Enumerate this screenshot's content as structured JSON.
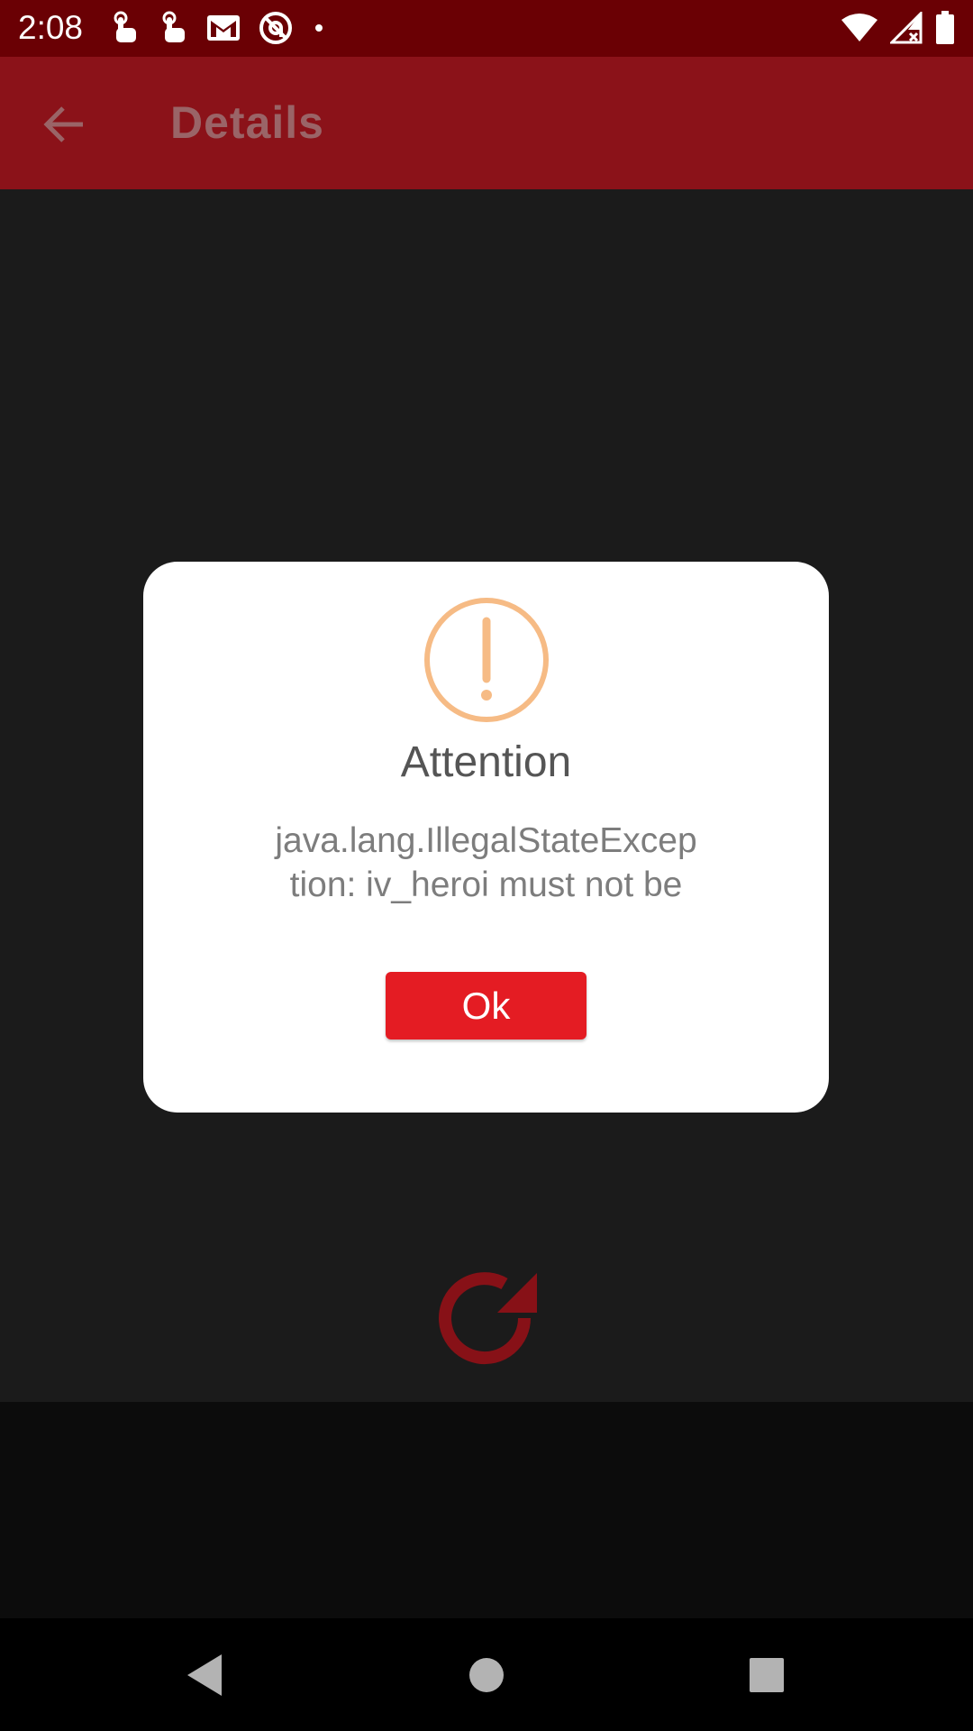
{
  "status_bar": {
    "time": "2:08",
    "icons": [
      "touch-icon",
      "touch-icon",
      "gmail-icon",
      "at-sign-icon",
      "dot-icon",
      "wifi-icon",
      "signal-icon",
      "battery-icon"
    ]
  },
  "app_bar": {
    "title": "Details",
    "back_icon": "arrow-back-icon"
  },
  "dialog": {
    "icon": "warning-icon",
    "title": "Attention",
    "message_line1": "java.lang.IllegalStateExcep",
    "message_line2": "tion: iv_heroi must not be",
    "ok_label": "Ok"
  },
  "content": {
    "reload_icon": "reload-icon"
  },
  "nav_bar": {
    "icons": [
      "back-triangle-icon",
      "home-circle-icon",
      "recents-square-icon"
    ]
  },
  "colors": {
    "status_bar": "#6a0004",
    "app_bar": "#8b1219",
    "background": "#1b1b1b",
    "accent": "#e41c23",
    "warning": "#f6bb85"
  }
}
